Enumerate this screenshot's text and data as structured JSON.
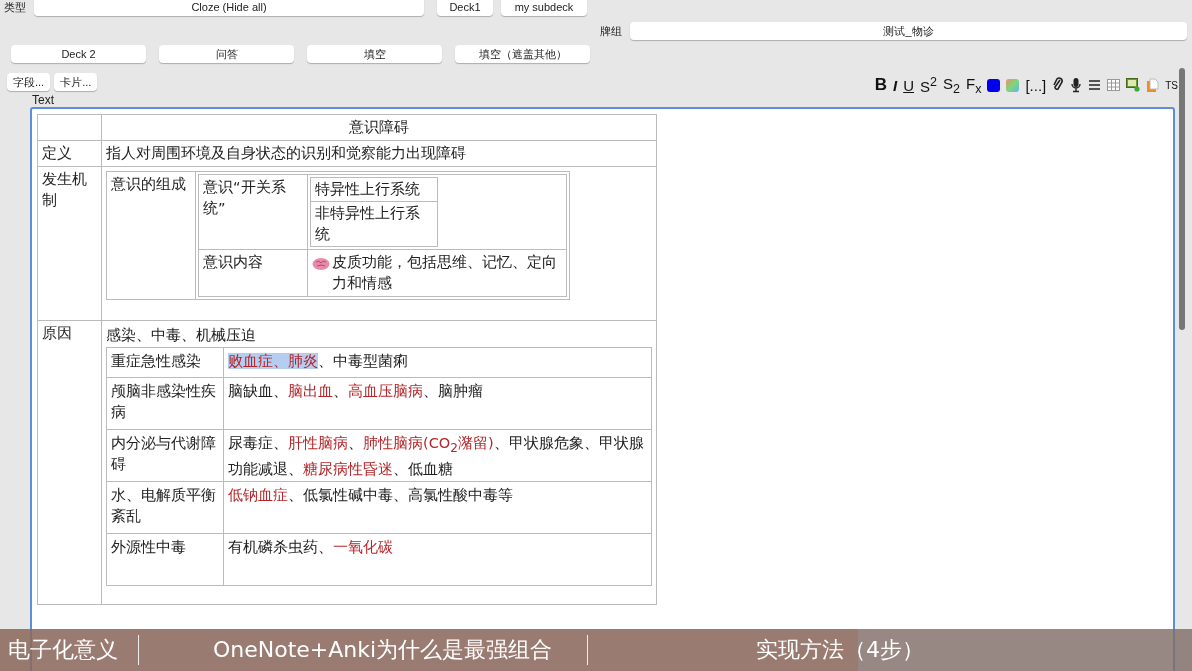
{
  "note_type": {
    "label": "类型",
    "value": "Cloze (Hide all)"
  },
  "deck_buttons_top": [
    "Deck1",
    "my subdeck"
  ],
  "deck": {
    "label": "牌组",
    "value": "测试_物诊"
  },
  "quick_buttons": [
    "Deck 2",
    "问答",
    "填空",
    "填空（遮盖其他）"
  ],
  "field_buttons": [
    "字段...",
    "卡片..."
  ],
  "toolbar": [
    {
      "kind": "bold",
      "label": "B"
    },
    {
      "kind": "italic",
      "label": "I"
    },
    {
      "kind": "underline",
      "label": "U"
    },
    {
      "kind": "text",
      "label": "S$^{2}$"
    },
    {
      "kind": "text",
      "label": "S$_{2}$"
    },
    {
      "kind": "text",
      "label": "F$_{x}$"
    },
    {
      "kind": "color"
    },
    {
      "kind": "highlight"
    },
    {
      "kind": "text",
      "label": "[...]"
    },
    {
      "kind": "attach"
    },
    {
      "kind": "mic"
    },
    {
      "kind": "lines"
    },
    {
      "kind": "table"
    },
    {
      "kind": "image"
    },
    {
      "kind": "doc"
    },
    {
      "kind": "small",
      "label": "TS"
    }
  ],
  "field_label": "Text",
  "table": {
    "title": "意识障碍",
    "definition": {
      "head": "定义",
      "text": "指人对周围环境及自身状态的识别和觉察能力出现障碍"
    },
    "mechanism": {
      "head": "发生机制",
      "component": "意识的组成",
      "switch": {
        "name": "意识“开关系统”",
        "systems": [
          "特异性上行系统",
          "非特异性上行系统"
        ]
      },
      "content": {
        "name": "意识内容",
        "text": "皮质功能，包括思维、记忆、定向力和情感"
      }
    },
    "causes": {
      "head": "原因",
      "intro": "感染、中毒、机械压迫",
      "rows": [
        {
          "name": "重症急性感染",
          "segments": [
            {
              "text": "败血症、肺炎",
              "red": true,
              "selected": true
            },
            {
              "text": "、中毒型菌痢",
              "red": false,
              "selected": false
            }
          ]
        },
        {
          "name": "颅脑非感染性疾病",
          "segments": [
            {
              "text": "脑缺血、",
              "red": false,
              "selected": false
            },
            {
              "text": "脑出血",
              "red": true,
              "selected": false
            },
            {
              "text": "、",
              "red": false,
              "selected": false
            },
            {
              "text": "高血压脑病",
              "red": true,
              "selected": false
            },
            {
              "text": "、脑肿瘤",
              "red": false,
              "selected": false
            }
          ]
        },
        {
          "name": "内分泌与代谢障碍",
          "segments": [
            {
              "text": "尿毒症、",
              "red": false,
              "selected": false
            },
            {
              "text": "肝性脑病",
              "red": true,
              "selected": false
            },
            {
              "text": "、",
              "red": false,
              "selected": false
            },
            {
              "text": "肺性脑病(CO$_{2}$潴留)",
              "red": true,
              "selected": false
            },
            {
              "text": "、甲状腺危象、甲状腺功能减退、",
              "red": false,
              "selected": false
            },
            {
              "text": "糖尿病性昏迷",
              "red": true,
              "selected": false
            },
            {
              "text": "、低血糖",
              "red": false,
              "selected": false
            }
          ]
        },
        {
          "name": "水、电解质平衡紊乱",
          "segments": [
            {
              "text": "低钠血症",
              "red": true,
              "selected": false
            },
            {
              "text": "、低氯性碱中毒、高氯性酸中毒等",
              "red": false,
              "selected": false
            }
          ]
        },
        {
          "name": "外源性中毒",
          "segments": [
            {
              "text": "有机磷杀虫药、",
              "red": false,
              "selected": false
            },
            {
              "text": "一氧化碳",
              "red": true,
              "selected": false
            }
          ]
        }
      ]
    }
  },
  "chapters": {
    "progress": {
      "level": 0.72
    },
    "items": [
      "电子化意义",
      "OneNote+Anki为什么是最强组合",
      "实现方法（4步）"
    ]
  }
}
